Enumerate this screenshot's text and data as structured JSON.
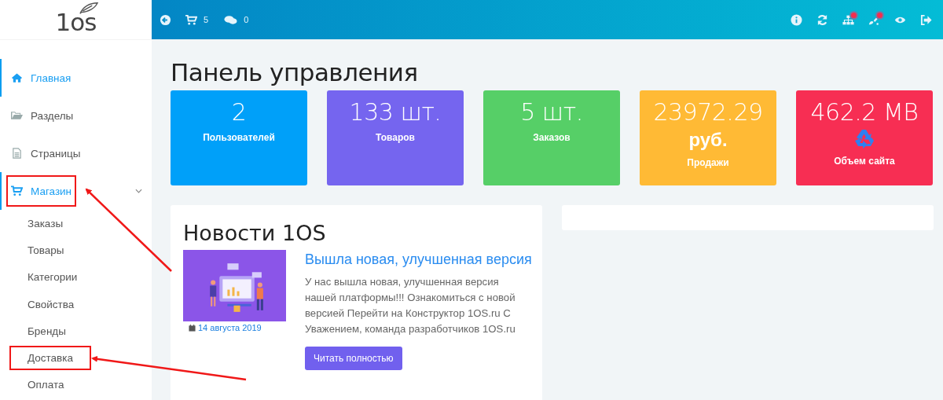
{
  "logo": "1os",
  "topbar": {
    "cart_count": "5",
    "comments_count": "0",
    "notifications": [
      {
        "kind": "info",
        "badge": false
      },
      {
        "kind": "refresh",
        "badge": false
      },
      {
        "kind": "sitemap",
        "badge": true
      },
      {
        "kind": "brush",
        "badge": true
      },
      {
        "kind": "view",
        "badge": false
      },
      {
        "kind": "logout",
        "badge": false
      }
    ]
  },
  "sidebar": {
    "items": [
      {
        "label": "Главная",
        "kind": "home",
        "selected": true,
        "highlighted": false
      },
      {
        "label": "Разделы",
        "kind": "folder",
        "selected": false,
        "highlighted": false
      },
      {
        "label": "Страницы",
        "kind": "file",
        "selected": false,
        "highlighted": false
      },
      {
        "label": "Магазин",
        "kind": "cart",
        "selected": true,
        "expanded": true,
        "highlighted": true,
        "children": [
          {
            "label": "Заказы",
            "highlighted": false
          },
          {
            "label": "Товары",
            "highlighted": false
          },
          {
            "label": "Категории",
            "highlighted": false
          },
          {
            "label": "Свойства",
            "highlighted": false
          },
          {
            "label": "Бренды",
            "highlighted": false
          },
          {
            "label": "Доставка",
            "highlighted": true
          },
          {
            "label": "Оплата",
            "highlighted": false
          }
        ]
      }
    ]
  },
  "page_title": "Панель управления",
  "stats": [
    {
      "kind": "plain",
      "value": "2",
      "label": "Пользователей",
      "color": "#00a0f9"
    },
    {
      "kind": "plain",
      "value": "133 шт.",
      "label": "Товаров",
      "color": "#7565ef"
    },
    {
      "kind": "plain",
      "value": "5 шт.",
      "label": "Заказов",
      "color": "#56cf67"
    },
    {
      "kind": "unit",
      "value": "23972.29",
      "unit": "руб.",
      "label": "Продажи",
      "color": "#ffba35"
    },
    {
      "kind": "icon",
      "value": "462.2 MB",
      "label": "Объем сайта",
      "color": "#f72e53"
    }
  ],
  "news": {
    "title": "Новости 1OS",
    "items": [
      {
        "date": "14 августа 2019",
        "headline": "Вышла новая, улучшенная версия",
        "text": "У нас вышла новая, улучшенная версия нашей платформы!!! Ознакомиться с новой версией Перейти на Конструктор 1OS.ru С Уважением, команда разработчиков 1OS.ru",
        "button": "Читать полностью"
      }
    ]
  }
}
